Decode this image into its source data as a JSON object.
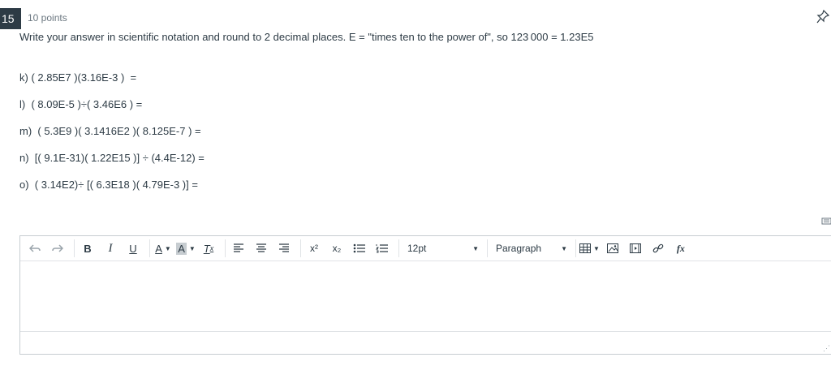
{
  "question": {
    "number": "15",
    "points": "10 points",
    "prompt": "Write your answer in scientific notation and round to 2 decimal places. E = \"times ten to the power of\", so 123 000 = 1.23E5",
    "problems": [
      "k) ( 2.85E7 )(3.16E-3 )  =",
      "l)  ( 8.09E-5 )÷( 3.46E6 ) =",
      "m)  ( 5.3E9 )( 3.1416E2 )( 8.125E-7 ) =",
      "n)  [( 9.1E-31)( 1.22E15 )] ÷ (4.4E-12) =",
      "o)  ( 3.14E2)÷ [( 6.3E18 )( 4.79E-3 )] ="
    ]
  },
  "editor": {
    "bold": "B",
    "italic": "I",
    "underline": "U",
    "font_color": "A",
    "highlight": "A",
    "clear_format": "T",
    "superscript": "x²",
    "subscript": "x₂",
    "font_size": "12pt",
    "block_format": "Paragraph",
    "formula": "fx"
  },
  "colors": {
    "question_badge": "#2d3b45",
    "text": "#2d3b45",
    "muted": "#6b7780",
    "border": "#c7cdd1"
  }
}
